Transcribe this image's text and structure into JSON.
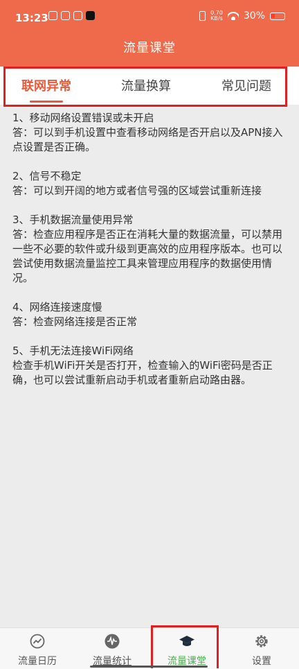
{
  "status": {
    "time": "13:23",
    "speed_value": "0.70",
    "speed_unit": "KB/s",
    "battery": "30%"
  },
  "header": {
    "title": "流量课堂"
  },
  "tabs": [
    {
      "label": "联网异常",
      "active": true
    },
    {
      "label": "流量换算",
      "active": false
    },
    {
      "label": "常见问题",
      "active": false
    }
  ],
  "items": [
    {
      "q": "1、移动网络设置错误或未开启",
      "a": "答：可以到手机设置中查看移动网络是否开启以及APN接入点设置是否正确。"
    },
    {
      "q": "2、信号不稳定",
      "a": "答：可以到开阔的地方或者信号强的区域尝试重新连接"
    },
    {
      "q": "3、手机数据流量使用异常",
      "a": "答：检查应用程序是否正在消耗大量的数据流量，可以禁用一些不必要的软件或升级到更高效的应用程序版本。也可以尝试使用数据流量监控工具来管理应用程序的数据使用情况。"
    },
    {
      "q": "4、网络连接速度慢",
      "a": "答：检查网络连接是否正常"
    },
    {
      "q": "5、手机无法连接WiFi网络",
      "a": "检查手机WiFi开关是否打开，检查输入的WiFi密码是否正确，也可以尝试重新启动手机或者重新启动路由器。"
    }
  ],
  "bottom_nav": [
    {
      "label": "流量日历",
      "icon": "trend-icon"
    },
    {
      "label": "流量统计",
      "icon": "waveform-icon"
    },
    {
      "label": "流量课堂",
      "icon": "graduation-cap-icon",
      "active": true
    },
    {
      "label": "设置",
      "icon": "gear-icon"
    }
  ],
  "colors": {
    "header": "#ee6a4b",
    "tab_active": "#e85a3c",
    "nav_active": "#4caf50",
    "highlight_box": "#e02020"
  }
}
